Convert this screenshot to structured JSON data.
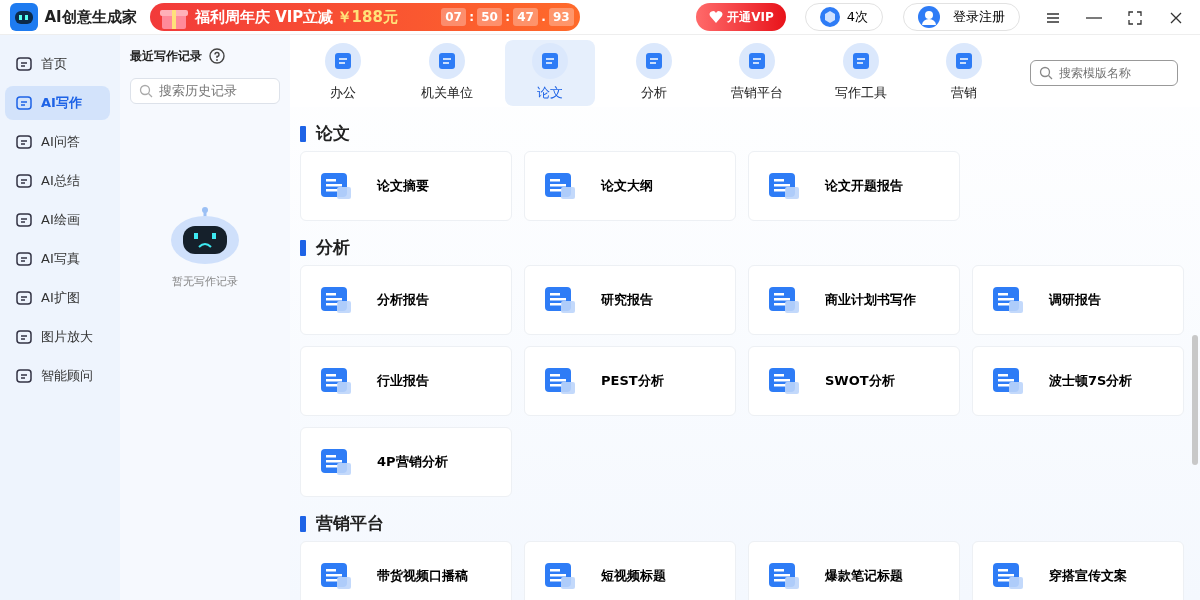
{
  "app": {
    "title": "AI创意生成家"
  },
  "promo": {
    "text": "福利周年庆 VIP立减",
    "price": "￥188元",
    "countdown": [
      "07",
      ":",
      "50",
      ":",
      "47",
      ".",
      "93"
    ]
  },
  "header_buttons": {
    "vip": "开通VIP",
    "credits": "4次",
    "login": "登录注册"
  },
  "nav": [
    {
      "label": "首页",
      "selected": false
    },
    {
      "label": "AI写作",
      "selected": true
    },
    {
      "label": "AI问答",
      "selected": false
    },
    {
      "label": "AI总结",
      "selected": false
    },
    {
      "label": "AI绘画",
      "selected": false
    },
    {
      "label": "AI写真",
      "selected": false
    },
    {
      "label": "AI扩图",
      "selected": false
    },
    {
      "label": "图片放大",
      "selected": false
    },
    {
      "label": "智能顾问",
      "selected": false
    }
  ],
  "history": {
    "title": "最近写作记录",
    "search_placeholder": "搜索历史记录",
    "empty_text": "暂无写作记录"
  },
  "categories": [
    {
      "label": "办公",
      "selected": false
    },
    {
      "label": "机关单位",
      "selected": false
    },
    {
      "label": "论文",
      "selected": true
    },
    {
      "label": "分析",
      "selected": false
    },
    {
      "label": "营销平台",
      "selected": false
    },
    {
      "label": "写作工具",
      "selected": false
    },
    {
      "label": "营销",
      "selected": false
    }
  ],
  "template_search": {
    "placeholder": "搜索模版名称"
  },
  "sections": [
    {
      "title": "论文",
      "items": [
        "论文摘要",
        "论文大纲",
        "论文开题报告"
      ]
    },
    {
      "title": "分析",
      "items": [
        "分析报告",
        "研究报告",
        "商业计划书写作",
        "调研报告",
        "行业报告",
        "PEST分析",
        "SWOT分析",
        "波士顿7S分析",
        "4P营销分析"
      ]
    },
    {
      "title": "营销平台",
      "items": [
        "带货视频口播稿",
        "短视频标题",
        "爆款笔记标题",
        "穿搭宣传文案"
      ]
    }
  ]
}
